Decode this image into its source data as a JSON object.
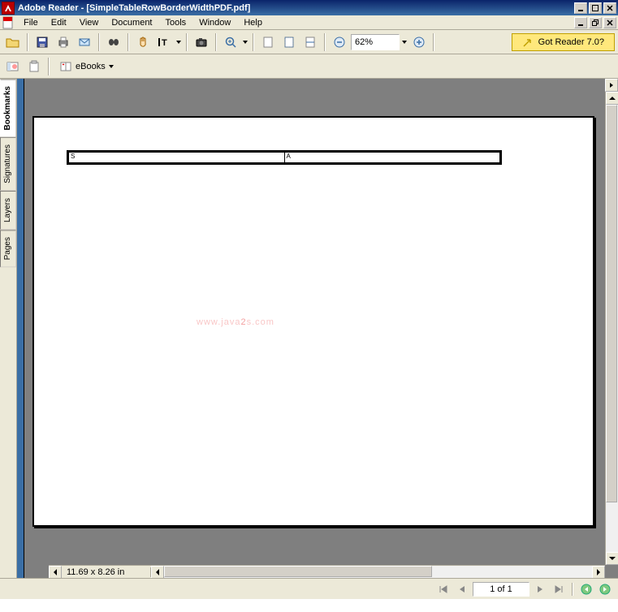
{
  "title": "Adobe Reader - [SimpleTableRowBorderWidthPDF.pdf]",
  "menus": [
    "File",
    "Edit",
    "View",
    "Document",
    "Tools",
    "Window",
    "Help"
  ],
  "zoom": "62%",
  "reader_badge": "Got Reader 7.0?",
  "ebooks_label": "eBooks",
  "side_tabs": {
    "bookmarks": "Bookmarks",
    "signatures": "Signatures",
    "layers": "Layers",
    "pages": "Pages"
  },
  "page_dim": "11.69 x 8.26 in",
  "page_counter": "1 of 1",
  "watermark_a": "www.java",
  "watermark_b": "2",
  "watermark_c": "s.com",
  "cell_a": "S",
  "cell_b": "A"
}
